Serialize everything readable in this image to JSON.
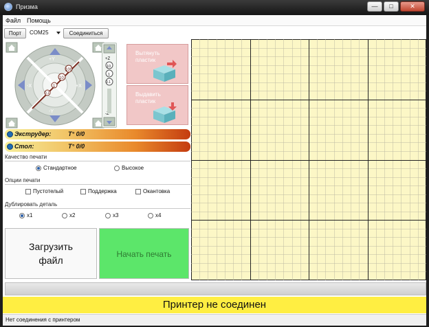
{
  "window": {
    "title": "Призма"
  },
  "menu": {
    "items": [
      "Файл",
      "Помощь"
    ]
  },
  "toolbar": {
    "port_label": "Порт",
    "port_value": "COM25",
    "connect_label": "Соединиться"
  },
  "jog": {
    "axis_labels": {
      "y_plus": "+Y",
      "y_minus": "-Y",
      "x_minus": "-X",
      "x_plus": "+X",
      "z_plus": "+Z",
      "z_minus": "-Z"
    },
    "step_labels": [
      "100",
      "10",
      "1",
      "0.1"
    ],
    "z_steps": [
      "10",
      "1",
      "0.1"
    ]
  },
  "extruder_buttons": {
    "pull_label": "Вытянуть пластик",
    "push_label": "Выдавить пластик"
  },
  "temps": [
    {
      "name": "Экструдер:",
      "value": "T° 0/0"
    },
    {
      "name": "Стол:",
      "value": "T° 0/0"
    }
  ],
  "quality": {
    "title": "Качество печати",
    "options": [
      "Стандартное",
      "Высокое"
    ],
    "selected": 0
  },
  "print_options": {
    "title": "Опции печати",
    "options": [
      "Пустотелый",
      "Поддержка",
      "Окантовка"
    ]
  },
  "duplicate": {
    "title": "Дублировать деталь",
    "options": [
      "x1",
      "x2",
      "x3",
      "x4"
    ],
    "selected": 0
  },
  "actions": {
    "load_label_1": "Загрузить",
    "load_label_2": "файл",
    "print_label": "Начать печать"
  },
  "status": {
    "banner": "Принтер не соединен",
    "bar": "Нет соединения с принтером"
  },
  "colors": {
    "grid_bg": "#fcf7c6",
    "print_button": "#5ce66a",
    "banner": "#ffee42"
  }
}
